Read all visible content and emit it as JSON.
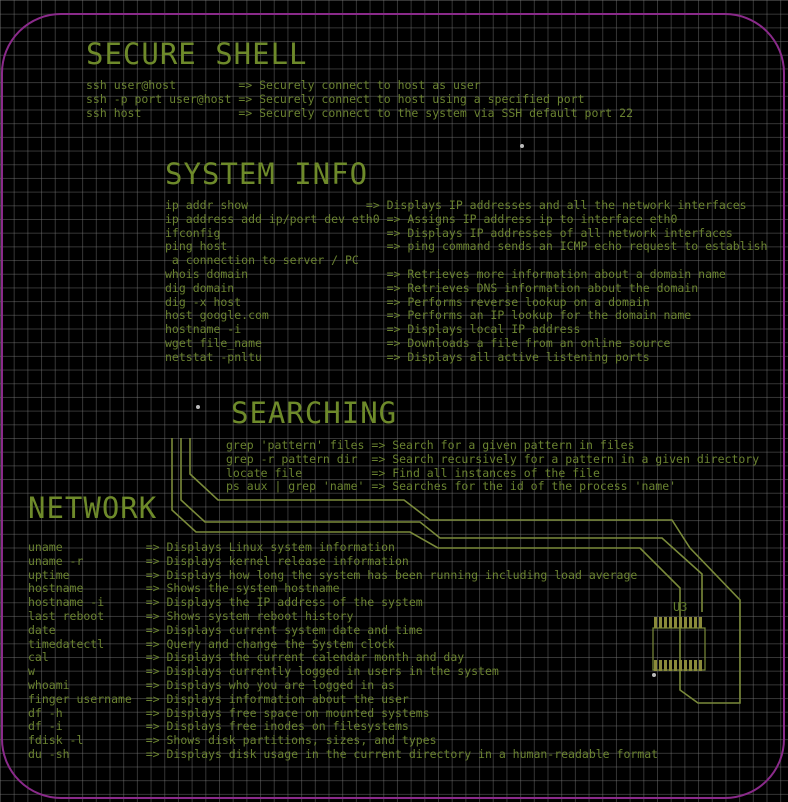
{
  "sections": {
    "secure_shell": {
      "title": "SECURE SHELL",
      "rows": [
        {
          "cmd": "ssh user@host        ",
          "desc": "=> Securely connect to host as user"
        },
        {
          "cmd": "ssh -p port user@host",
          "desc": "=> Securely connect to host using a specified port"
        },
        {
          "cmd": "ssh host             ",
          "desc": "=> Securely connect to the system via SSH default port 22"
        }
      ]
    },
    "system_info": {
      "title": "SYSTEM INFO",
      "rows": [
        {
          "cmd": "ip addr show                ",
          "desc": "=> Displays IP addresses and all the network interfaces"
        },
        {
          "cmd": "ip address add ip/port dev eth0",
          "desc": "=> Assigns IP address ip to interface eth0"
        },
        {
          "cmd": "ifconfig                       ",
          "desc": "=> Displays IP addresses of all network interfaces"
        },
        {
          "cmd": "ping host                      ",
          "desc": "=> ping command sends an ICMP echo request to establish"
        },
        {
          "cmd": " a connection to server / PC",
          "desc": ""
        },
        {
          "cmd": "whois domain                   ",
          "desc": "=> Retrieves more information about a domain name"
        },
        {
          "cmd": "dig domain                     ",
          "desc": "=> Retrieves DNS information about the domain"
        },
        {
          "cmd": "dig -x host                    ",
          "desc": "=> Performs reverse lookup on a domain"
        },
        {
          "cmd": "host google.com                ",
          "desc": "=> Performs an IP lookup for the domain name"
        },
        {
          "cmd": "hostname -i                    ",
          "desc": "=> Displays local IP address"
        },
        {
          "cmd": "wget file_name                 ",
          "desc": "=> Downloads a file from an online source"
        },
        {
          "cmd": "netstat -pnltu                 ",
          "desc": "=> Displays all active listening ports"
        }
      ]
    },
    "searching": {
      "title": "SEARCHING",
      "rows": [
        {
          "cmd": "grep 'pattern' files",
          "desc": "=> Search for a given pattern in files"
        },
        {
          "cmd": "grep -r pattern dir ",
          "desc": "=> Search recursively for a pattern in a given directory"
        },
        {
          "cmd": "locate file         ",
          "desc": "=> Find all instances of the file"
        },
        {
          "cmd": "ps aux | grep 'name'",
          "desc": "=> Searches for the id of the process 'name'"
        }
      ]
    },
    "network": {
      "title": "NETWORK",
      "rows": [
        {
          "cmd": "uname           ",
          "desc": "=> Displays Linux system information"
        },
        {
          "cmd": "uname -r        ",
          "desc": "=> Displays kernel release information"
        },
        {
          "cmd": "uptime          ",
          "desc": "=> Displays how long the system has been running including load average"
        },
        {
          "cmd": "hostname        ",
          "desc": "=> Shows the system hostname"
        },
        {
          "cmd": "hostname -i     ",
          "desc": "=> Displays the IP address of the system"
        },
        {
          "cmd": "last reboot     ",
          "desc": "=> Shows system reboot history"
        },
        {
          "cmd": "date            ",
          "desc": "=> Displays current system date and time"
        },
        {
          "cmd": "timedatectl     ",
          "desc": "=> Query and change the System clock"
        },
        {
          "cmd": "cal             ",
          "desc": "=> Displays the current calendar month and day"
        },
        {
          "cmd": "w               ",
          "desc": "=> Displays currently logged in users in the system"
        },
        {
          "cmd": "whoami          ",
          "desc": "=> Displays who you are logged in as"
        },
        {
          "cmd": "finger username ",
          "desc": "=> Displays information about the user"
        },
        {
          "cmd": "df -h           ",
          "desc": "=> Displays free space on mounted systems"
        },
        {
          "cmd": "df -i           ",
          "desc": "=> Displays free inodes on filesystems"
        },
        {
          "cmd": "fdisk -l        ",
          "desc": "=> Shows disk partitions, sizes, and types"
        },
        {
          "cmd": "du -sh          ",
          "desc": "=> Displays disk usage in the current directory in a human-readable format"
        }
      ]
    }
  },
  "component": {
    "ref": "U3"
  },
  "colors": {
    "text": "#6a8230",
    "heading": "#6e8a2a",
    "trace": "#7a8a3a",
    "outline": "#8a2a8a"
  }
}
